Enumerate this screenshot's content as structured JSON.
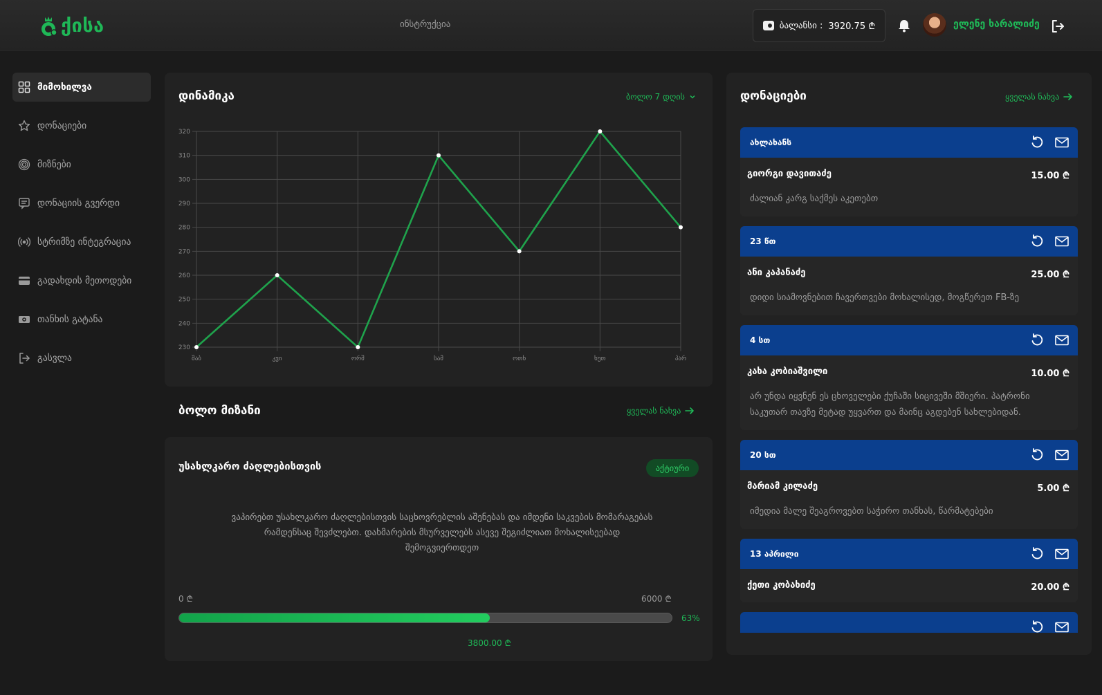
{
  "header": {
    "logo_text": "ქისა",
    "nav_link": "ინსტრუქცია",
    "balance_label": "ბალანსი :",
    "balance_value": "3920.75 ₾",
    "user_name": "ელენე ხარალიძე"
  },
  "sidebar": {
    "items": [
      {
        "label": "მიმოხილვა",
        "icon": "grid-icon",
        "active": true
      },
      {
        "label": "დონაციები",
        "icon": "star-icon"
      },
      {
        "label": "მიზნები",
        "icon": "target-icon"
      },
      {
        "label": "დონაციის გვერდი",
        "icon": "page-icon"
      },
      {
        "label": "სტრიმზე ინტეგრაცია",
        "icon": "broadcast-icon"
      },
      {
        "label": "გადახდის მეთოდები",
        "icon": "card-icon"
      },
      {
        "label": "თანხის გატანა",
        "icon": "money-icon"
      },
      {
        "label": "გასვლა",
        "icon": "logout-icon"
      }
    ]
  },
  "dynamics": {
    "title": "დინამიკა",
    "period_label": "ბოლო 7 დღის"
  },
  "chart_data": {
    "type": "line",
    "categories": [
      "შაბ",
      "კვი",
      "ორშ",
      "სამ",
      "ოთხ",
      "ხუთ",
      "პარ"
    ],
    "series": [
      {
        "values": [
          230,
          260,
          230,
          310,
          270,
          320,
          280
        ]
      }
    ],
    "ylim": [
      230,
      320
    ],
    "yticks": [
      230,
      240,
      250,
      260,
      270,
      280,
      290,
      300,
      310,
      320
    ],
    "grid": true,
    "color": "#1fa34c"
  },
  "last_goal": {
    "section_title": "ბოლო მიზანი",
    "view_all": "ყველას ნახვა",
    "name": "უსახლკარო ძაღლებისთვის",
    "status": "აქტიური",
    "description": "ვაპირებთ უსახლკარო ძაღლებისთვის საცხოვრებლის აშენებას და იმდენი საკვების მომარაგებას რამდენსაც შევძლებთ. დახმარების მსურველებს ასევე შეგიძლიათ მოხალისეებად შემოგვიერთდეთ",
    "min_label": "0 ₾",
    "max_label": "6000 ₾",
    "progress": 0.63,
    "progress_label": "63%",
    "current_label": "3800.00 ₾"
  },
  "donations": {
    "title": "დონაციები",
    "view_all": "ყველას ნახვა",
    "items": [
      {
        "time": "ახლახანს",
        "name": "გიორგი დავითაძე",
        "amount": "15.00 ₾",
        "message": "ძალიან კარგ საქმეს აკეთებთ"
      },
      {
        "time": "23 წთ",
        "name": "ანი კაპანაძე",
        "amount": "25.00 ₾",
        "message": "დიდი სიამოვნებით ჩავერთვები მოხალისედ, მოგწერეთ FB-ზე"
      },
      {
        "time": "4 სთ",
        "name": "კახა კობიაშვილი",
        "amount": "10.00 ₾",
        "message": "არ უნდა იყვნენ ეს ცხოველები ქუჩაში სიცივეში მშიერი. პატრონი საკუთარ თავზე მეტად უყვართ და მაინც აგდებენ სახლებიდან."
      },
      {
        "time": "20 სთ",
        "name": "მარიამ კილაძე",
        "amount": "5.00 ₾",
        "message": "იმედია მალე შეაგროვებთ საჭირო თანხას, წარმატებები"
      },
      {
        "time": "13 აპრილი",
        "name": "ქეთი კობახიძე",
        "amount": "20.00 ₾",
        "message": ""
      },
      {
        "time": "",
        "name": "",
        "amount": "",
        "message": ""
      }
    ]
  }
}
